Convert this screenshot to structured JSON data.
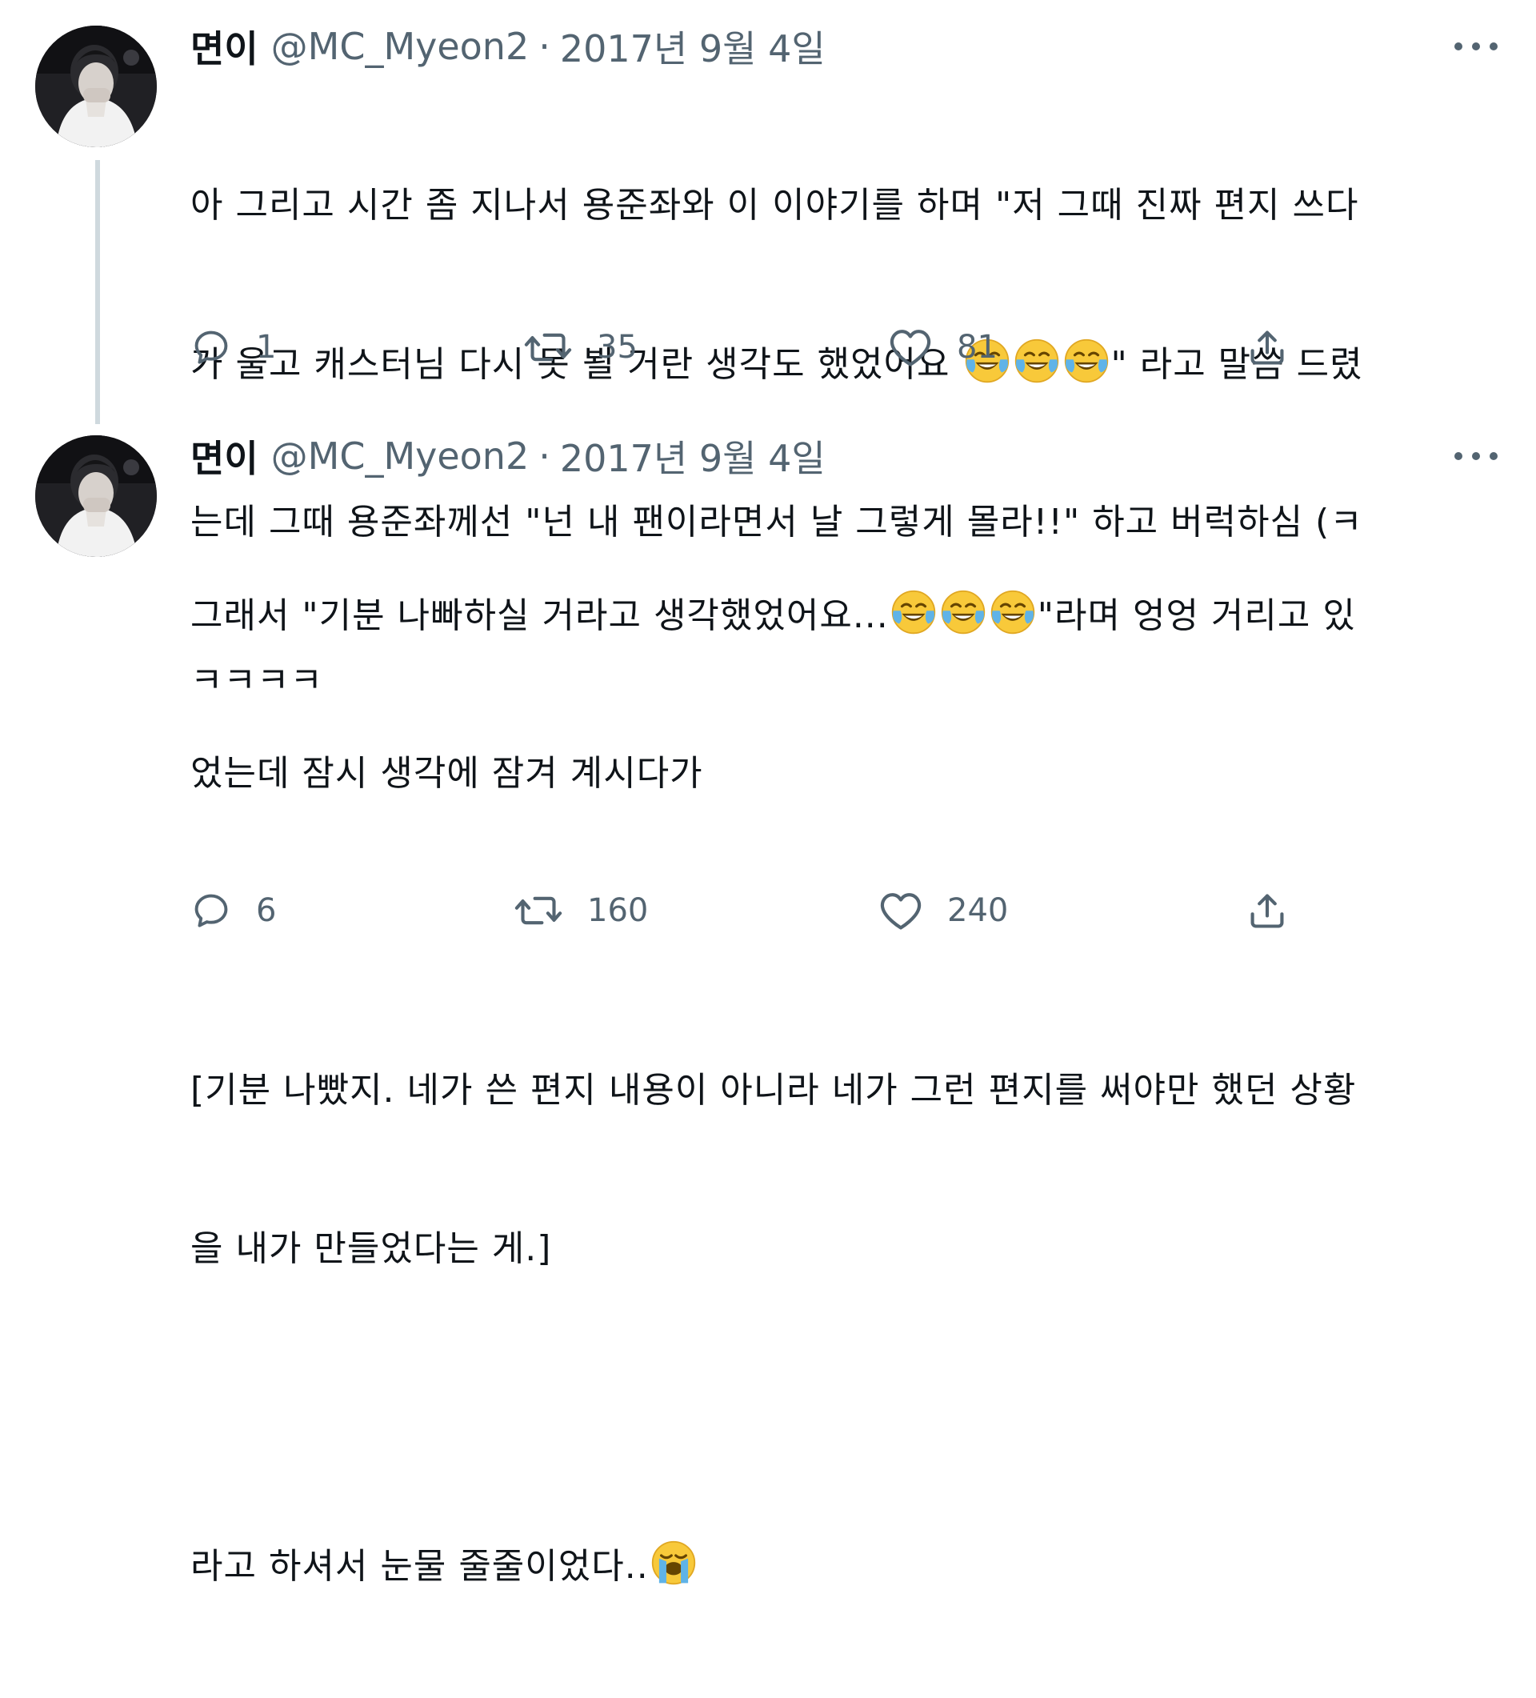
{
  "tweets": [
    {
      "author": {
        "name": "면이",
        "handle": "@MC_Myeon2",
        "separator": "·",
        "date": "2017년 9월 4일",
        "avatar": "profile-photo"
      },
      "lines": [
        "아 그리고 시간 좀 지나서 용준좌와 이 이야기를 하며 \"저 그때 진짜 편지 쓰다",
        "가 울고 캐스터님 다시 못 뵐 거란 생각도 했었어요",
        "\" 라고 말씀 드렸",
        "는데 그때 용준좌께선 \"넌 내 팬이라면서 날 그렇게 몰라!!\" 하고 버럭하심 (ㅋ",
        "ㅋㅋㅋㅋ"
      ],
      "emoji": "face-with-tears-of-joy",
      "stats": {
        "replies": "1",
        "retweets": "35",
        "likes": "81"
      }
    },
    {
      "author": {
        "name": "면이",
        "handle": "@MC_Myeon2",
        "separator": "·",
        "date": "2017년 9월 4일",
        "avatar": "profile-photo"
      },
      "lines": [
        "그래서 \"기분 나빠하실 거라고 생각했었어요...",
        "\"라며 엉엉 거리고 있",
        "었는데 잠시 생각에 잠겨 계시다가",
        "[기분 나빴지. 네가 쓴 편지 내용이 아니라 네가 그런 편지를 써야만 했던 상황",
        "을 내가 만들었다는 게.]",
        "라고 하셔서 눈물 줄줄이었다.."
      ],
      "emoji": "face-with-tears-of-joy",
      "end_emoji": "loudly-crying-face",
      "stats": {
        "replies": "6",
        "retweets": "160",
        "likes": "240"
      }
    }
  ],
  "icons": {
    "reply": "reply-icon",
    "retweet": "retweet-icon",
    "like": "heart-icon",
    "share": "share-icon",
    "more": "more-icon"
  },
  "colors": {
    "text": "#0f1419",
    "secondary": "#536471",
    "thread_line": "#cfd9de",
    "emoji_yellow": "#f8c93a",
    "tear_blue": "#5fb3e8"
  }
}
